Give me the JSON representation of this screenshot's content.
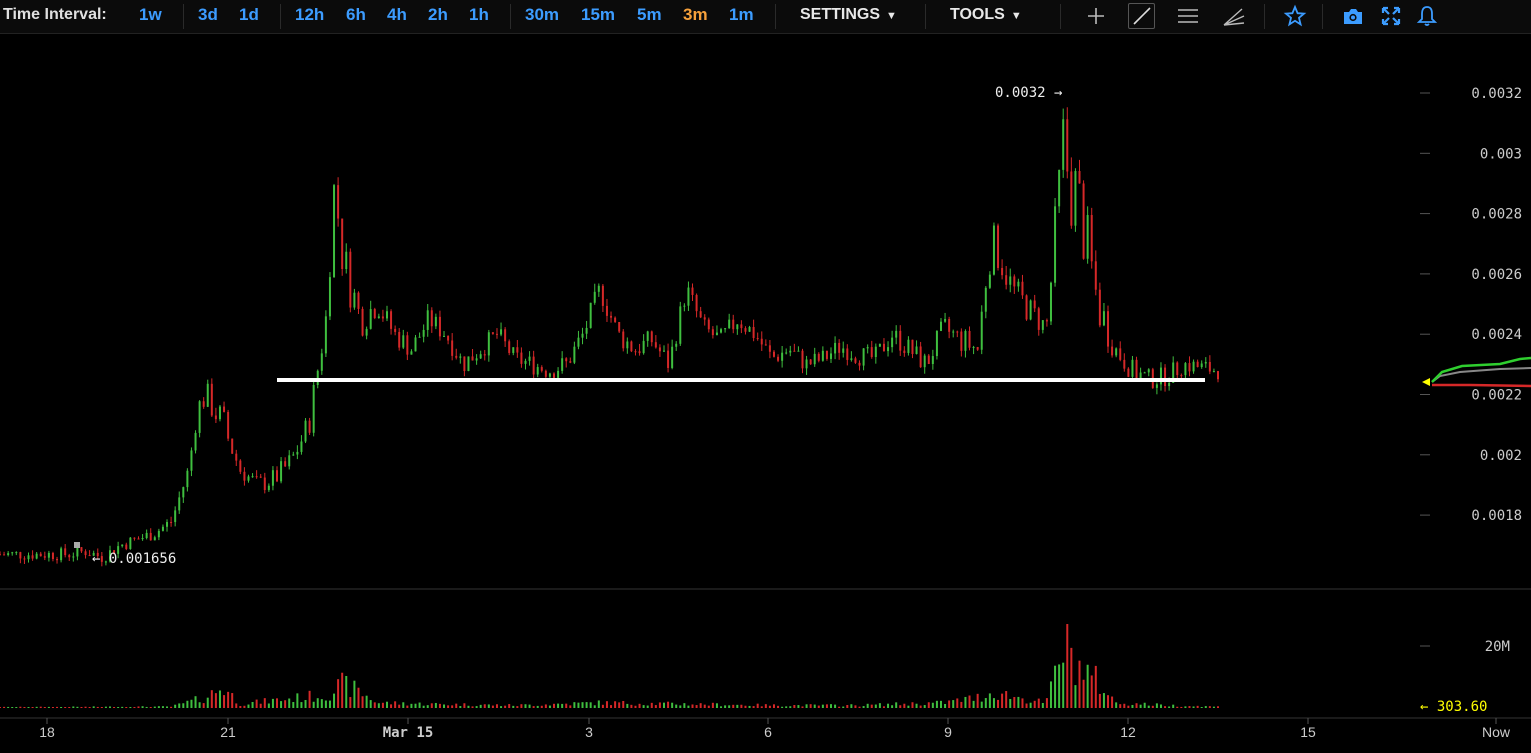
{
  "toolbar": {
    "time_interval_label": "Time Interval:",
    "intervals": [
      "1w",
      "3d",
      "1d",
      "12h",
      "6h",
      "4h",
      "2h",
      "1h",
      "30m",
      "15m",
      "5m",
      "3m",
      "1m"
    ],
    "active_interval": "3m",
    "settings_label": "SETTINGS",
    "tools_label": "TOOLS",
    "icons": [
      "crosshair-icon",
      "trendline-icon",
      "horizontal-lines-icon",
      "fan-icon",
      "star-icon",
      "camera-icon",
      "fullscreen-icon",
      "bell-icon"
    ]
  },
  "colors": {
    "up": "#3fbf3f",
    "down": "#d62828",
    "accent": "#3c9cff",
    "active_interval": "#f7a13b",
    "volume_marker": "#ffff00"
  },
  "chart_data": {
    "type": "candlestick",
    "price_axis": {
      "ticks": [
        "0.0032",
        "0.003",
        "0.0028",
        "0.0026",
        "0.0024",
        "0.0022",
        "0.002",
        "0.0018"
      ],
      "range": [
        0.00165,
        0.00325
      ]
    },
    "volume_axis": {
      "ticks": [
        "20M"
      ],
      "range": [
        0,
        35
      ]
    },
    "x_ticks": [
      "18",
      "21",
      "Mar 15",
      "3",
      "6",
      "9",
      "12",
      "15",
      "Now"
    ],
    "annotations": {
      "high_label": "0.0032 →",
      "low_label": "← 0.001656",
      "current_volume": "← 303.60"
    },
    "horizontal_line": {
      "price": 0.002248
    },
    "price_path": [
      [
        0,
        0.00167
      ],
      [
        4,
        0.00167
      ],
      [
        5,
        0.00168
      ],
      [
        6,
        0.00166
      ],
      [
        7,
        0.0017
      ],
      [
        8,
        0.00172
      ],
      [
        9,
        0.00174
      ],
      [
        10,
        0.00178
      ],
      [
        11,
        0.00195
      ],
      [
        11.5,
        0.00215
      ],
      [
        12,
        0.0022
      ],
      [
        13,
        0.0021
      ],
      [
        14,
        0.00195
      ],
      [
        15,
        0.0019
      ],
      [
        16,
        0.00192
      ],
      [
        17,
        0.00198
      ],
      [
        18,
        0.0021
      ],
      [
        19,
        0.00245
      ],
      [
        19.5,
        0.0029
      ],
      [
        20,
        0.00265
      ],
      [
        21,
        0.00245
      ],
      [
        22,
        0.0025
      ],
      [
        23,
        0.0024
      ],
      [
        24,
        0.00235
      ],
      [
        25,
        0.00245
      ],
      [
        26,
        0.0024
      ],
      [
        27,
        0.0023
      ],
      [
        28,
        0.00235
      ],
      [
        29,
        0.0024
      ],
      [
        30,
        0.00232
      ],
      [
        31,
        0.0023
      ],
      [
        32,
        0.00228
      ],
      [
        33,
        0.0023
      ],
      [
        34,
        0.0024
      ],
      [
        35,
        0.00255
      ],
      [
        36,
        0.0024
      ],
      [
        37,
        0.00235
      ],
      [
        38,
        0.00238
      ],
      [
        39,
        0.0023
      ],
      [
        40,
        0.00255
      ],
      [
        41,
        0.00242
      ],
      [
        42,
        0.00238
      ],
      [
        43,
        0.00245
      ],
      [
        44,
        0.0024
      ],
      [
        45,
        0.00232
      ],
      [
        46,
        0.00235
      ],
      [
        47,
        0.0023
      ],
      [
        48,
        0.00232
      ],
      [
        49,
        0.00236
      ],
      [
        50,
        0.00233
      ],
      [
        51,
        0.00232
      ],
      [
        52,
        0.0024
      ],
      [
        53,
        0.00235
      ],
      [
        54,
        0.0023
      ],
      [
        55,
        0.00242
      ],
      [
        56,
        0.00238
      ],
      [
        57,
        0.00235
      ],
      [
        57.6,
        0.00265
      ],
      [
        58,
        0.0027
      ],
      [
        59,
        0.00255
      ],
      [
        60,
        0.00248
      ],
      [
        61,
        0.00242
      ],
      [
        62,
        0.003
      ],
      [
        63,
        0.0028
      ],
      [
        64,
        0.0025
      ],
      [
        65,
        0.00235
      ],
      [
        66,
        0.00228
      ],
      [
        67,
        0.00225
      ],
      [
        68,
        0.00226
      ],
      [
        69,
        0.0023
      ],
      [
        70,
        0.00229
      ],
      [
        71,
        0.00228
      ]
    ],
    "volume_path": [
      [
        0,
        0.3
      ],
      [
        10,
        0.5
      ],
      [
        12,
        4
      ],
      [
        13,
        8
      ],
      [
        14,
        1.5
      ],
      [
        19,
        5
      ],
      [
        20,
        9
      ],
      [
        21,
        6
      ],
      [
        22,
        2
      ],
      [
        25,
        1.5
      ],
      [
        30,
        1
      ],
      [
        35,
        2
      ],
      [
        40,
        1.5
      ],
      [
        45,
        1
      ],
      [
        50,
        1
      ],
      [
        55,
        2
      ],
      [
        57,
        4
      ],
      [
        58,
        6
      ],
      [
        60,
        3
      ],
      [
        61,
        2
      ],
      [
        62,
        24
      ],
      [
        63,
        15
      ],
      [
        64,
        10
      ],
      [
        65,
        2
      ],
      [
        68,
        1
      ],
      [
        71,
        0.5
      ]
    ]
  }
}
